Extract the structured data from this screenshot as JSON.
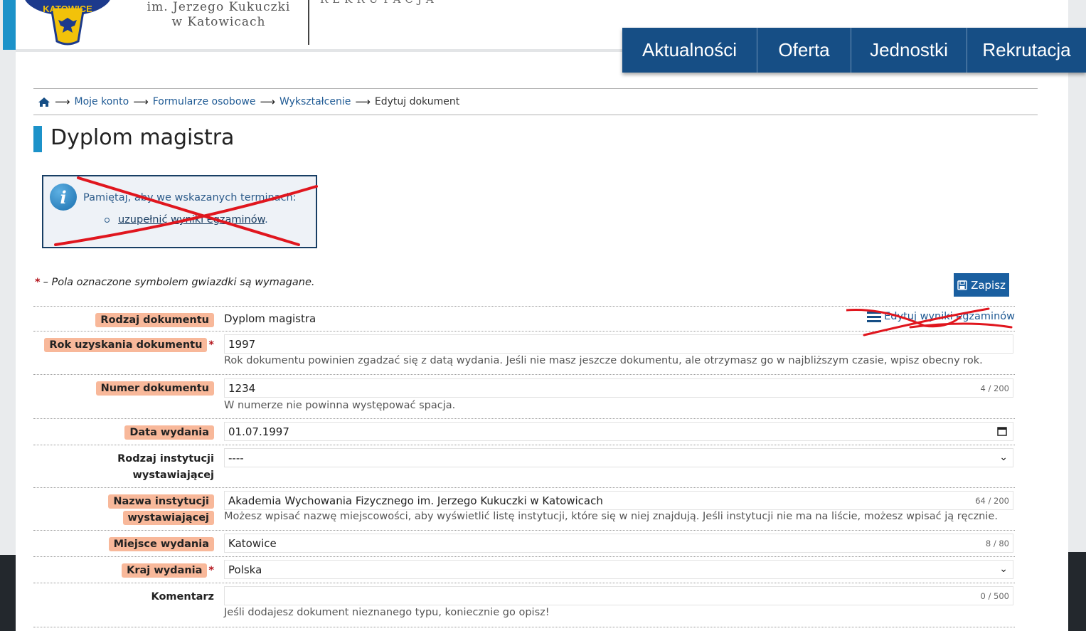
{
  "header": {
    "logo_text": "KATOWICE",
    "university_line1": "im. Jerzego Kukuczki",
    "university_line2": "w Katowicach",
    "section_label": "REKRUTACJA",
    "nav": [
      "Aktualności",
      "Oferta",
      "Jednostki",
      "Rekrutacja"
    ]
  },
  "breadcrumb": {
    "items": [
      "Moje konto",
      "Formularze osobowe",
      "Wykształcenie"
    ],
    "current": "Edytuj dokument"
  },
  "page": {
    "title": "Dyplom magistra"
  },
  "info_box": {
    "text": "Pamiętaj, aby we wskazanych terminach:",
    "link": "uzupełnić wyniki egzaminów",
    "link_suffix": "."
  },
  "form": {
    "required_note": "– Pola oznaczone symbolem gwiazdki są wymagane.",
    "save_label": "Zapisz",
    "edit_exam_link": "Edytuj wyniki egzaminów",
    "rows": {
      "doc_type": {
        "label": "Rodzaj dokumentu",
        "value": "Dyplom magistra"
      },
      "year": {
        "label": "Rok uzyskania dokumentu",
        "value": "1997",
        "hint": "Rok dokumentu powinien zgadzać się z datą wydania. Jeśli nie masz jeszcze dokumentu, ale otrzymasz go w najbliższym czasie, wpisz obecny rok."
      },
      "number": {
        "label": "Numer dokumentu",
        "value": "1234",
        "counter": "4 / 200",
        "hint": "W numerze nie powinna występować spacja."
      },
      "issue_date": {
        "label": "Data wydania",
        "value": "01.07.1997"
      },
      "institution_type": {
        "label_line1": "Rodzaj instytucji",
        "label_line2": "wystawiającej",
        "value": "----"
      },
      "institution_name": {
        "label_line1": "Nazwa instytucji",
        "label_line2": "wystawiającej",
        "value": "Akademia Wychowania Fizycznego im. Jerzego Kukuczki w Katowicach",
        "counter": "64 / 200",
        "hint": "Możesz wpisać nazwę miejscowości, aby wyświetlić listę instytucji, które się w niej znajdują. Jeśli instytucji nie ma na liście, możesz wpisać ją ręcznie."
      },
      "place": {
        "label": "Miejsce wydania",
        "value": "Katowice",
        "counter": "8 / 80"
      },
      "country": {
        "label": "Kraj wydania",
        "value": "Polska"
      },
      "comment": {
        "label": "Komentarz",
        "value": "",
        "counter": "0 / 500",
        "hint": "Jeśli dodajesz dokument nieznanego typu, koniecznie go opisz!"
      }
    }
  },
  "colors": {
    "nav_bg": "#164e85",
    "accent": "#1c92c9",
    "required_star": "#b3131b",
    "highlight": "#f5a078",
    "annotation_red": "#e0161e"
  }
}
